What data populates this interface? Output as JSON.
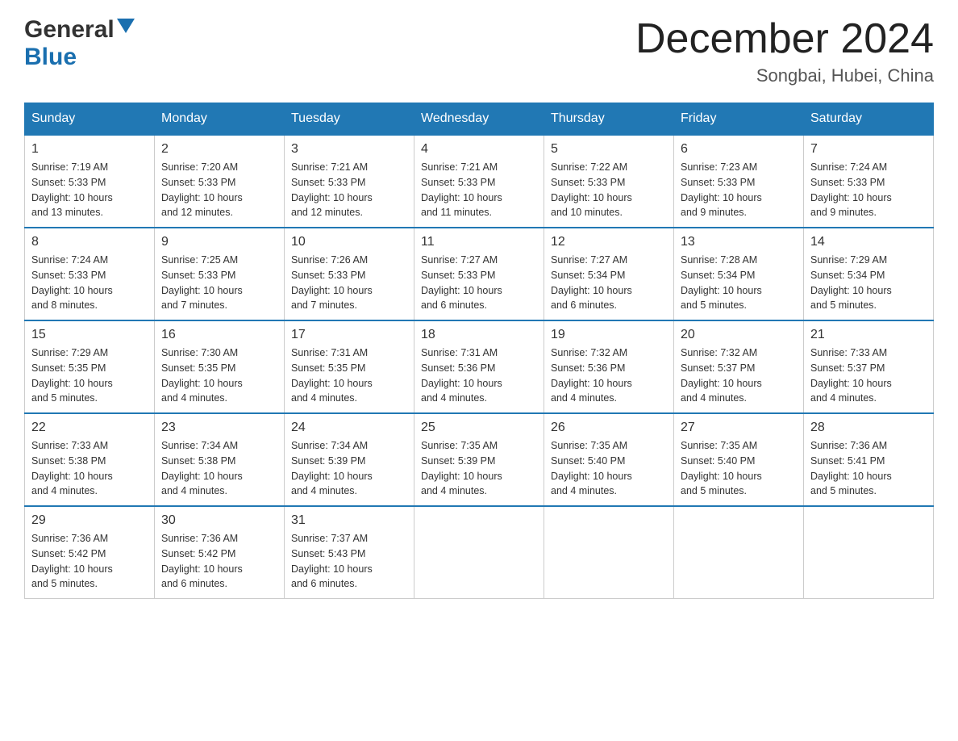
{
  "header": {
    "logo_general": "General",
    "logo_blue": "Blue",
    "month_title": "December 2024",
    "location": "Songbai, Hubei, China"
  },
  "days_of_week": [
    "Sunday",
    "Monday",
    "Tuesday",
    "Wednesday",
    "Thursday",
    "Friday",
    "Saturday"
  ],
  "weeks": [
    [
      {
        "day": "1",
        "sunrise": "7:19 AM",
        "sunset": "5:33 PM",
        "daylight": "10 hours and 13 minutes."
      },
      {
        "day": "2",
        "sunrise": "7:20 AM",
        "sunset": "5:33 PM",
        "daylight": "10 hours and 12 minutes."
      },
      {
        "day": "3",
        "sunrise": "7:21 AM",
        "sunset": "5:33 PM",
        "daylight": "10 hours and 12 minutes."
      },
      {
        "day": "4",
        "sunrise": "7:21 AM",
        "sunset": "5:33 PM",
        "daylight": "10 hours and 11 minutes."
      },
      {
        "day": "5",
        "sunrise": "7:22 AM",
        "sunset": "5:33 PM",
        "daylight": "10 hours and 10 minutes."
      },
      {
        "day": "6",
        "sunrise": "7:23 AM",
        "sunset": "5:33 PM",
        "daylight": "10 hours and 9 minutes."
      },
      {
        "day": "7",
        "sunrise": "7:24 AM",
        "sunset": "5:33 PM",
        "daylight": "10 hours and 9 minutes."
      }
    ],
    [
      {
        "day": "8",
        "sunrise": "7:24 AM",
        "sunset": "5:33 PM",
        "daylight": "10 hours and 8 minutes."
      },
      {
        "day": "9",
        "sunrise": "7:25 AM",
        "sunset": "5:33 PM",
        "daylight": "10 hours and 7 minutes."
      },
      {
        "day": "10",
        "sunrise": "7:26 AM",
        "sunset": "5:33 PM",
        "daylight": "10 hours and 7 minutes."
      },
      {
        "day": "11",
        "sunrise": "7:27 AM",
        "sunset": "5:33 PM",
        "daylight": "10 hours and 6 minutes."
      },
      {
        "day": "12",
        "sunrise": "7:27 AM",
        "sunset": "5:34 PM",
        "daylight": "10 hours and 6 minutes."
      },
      {
        "day": "13",
        "sunrise": "7:28 AM",
        "sunset": "5:34 PM",
        "daylight": "10 hours and 5 minutes."
      },
      {
        "day": "14",
        "sunrise": "7:29 AM",
        "sunset": "5:34 PM",
        "daylight": "10 hours and 5 minutes."
      }
    ],
    [
      {
        "day": "15",
        "sunrise": "7:29 AM",
        "sunset": "5:35 PM",
        "daylight": "10 hours and 5 minutes."
      },
      {
        "day": "16",
        "sunrise": "7:30 AM",
        "sunset": "5:35 PM",
        "daylight": "10 hours and 4 minutes."
      },
      {
        "day": "17",
        "sunrise": "7:31 AM",
        "sunset": "5:35 PM",
        "daylight": "10 hours and 4 minutes."
      },
      {
        "day": "18",
        "sunrise": "7:31 AM",
        "sunset": "5:36 PM",
        "daylight": "10 hours and 4 minutes."
      },
      {
        "day": "19",
        "sunrise": "7:32 AM",
        "sunset": "5:36 PM",
        "daylight": "10 hours and 4 minutes."
      },
      {
        "day": "20",
        "sunrise": "7:32 AM",
        "sunset": "5:37 PM",
        "daylight": "10 hours and 4 minutes."
      },
      {
        "day": "21",
        "sunrise": "7:33 AM",
        "sunset": "5:37 PM",
        "daylight": "10 hours and 4 minutes."
      }
    ],
    [
      {
        "day": "22",
        "sunrise": "7:33 AM",
        "sunset": "5:38 PM",
        "daylight": "10 hours and 4 minutes."
      },
      {
        "day": "23",
        "sunrise": "7:34 AM",
        "sunset": "5:38 PM",
        "daylight": "10 hours and 4 minutes."
      },
      {
        "day": "24",
        "sunrise": "7:34 AM",
        "sunset": "5:39 PM",
        "daylight": "10 hours and 4 minutes."
      },
      {
        "day": "25",
        "sunrise": "7:35 AM",
        "sunset": "5:39 PM",
        "daylight": "10 hours and 4 minutes."
      },
      {
        "day": "26",
        "sunrise": "7:35 AM",
        "sunset": "5:40 PM",
        "daylight": "10 hours and 4 minutes."
      },
      {
        "day": "27",
        "sunrise": "7:35 AM",
        "sunset": "5:40 PM",
        "daylight": "10 hours and 5 minutes."
      },
      {
        "day": "28",
        "sunrise": "7:36 AM",
        "sunset": "5:41 PM",
        "daylight": "10 hours and 5 minutes."
      }
    ],
    [
      {
        "day": "29",
        "sunrise": "7:36 AM",
        "sunset": "5:42 PM",
        "daylight": "10 hours and 5 minutes."
      },
      {
        "day": "30",
        "sunrise": "7:36 AM",
        "sunset": "5:42 PM",
        "daylight": "10 hours and 6 minutes."
      },
      {
        "day": "31",
        "sunrise": "7:37 AM",
        "sunset": "5:43 PM",
        "daylight": "10 hours and 6 minutes."
      },
      null,
      null,
      null,
      null
    ]
  ],
  "labels": {
    "sunrise": "Sunrise:",
    "sunset": "Sunset:",
    "daylight": "Daylight:"
  }
}
